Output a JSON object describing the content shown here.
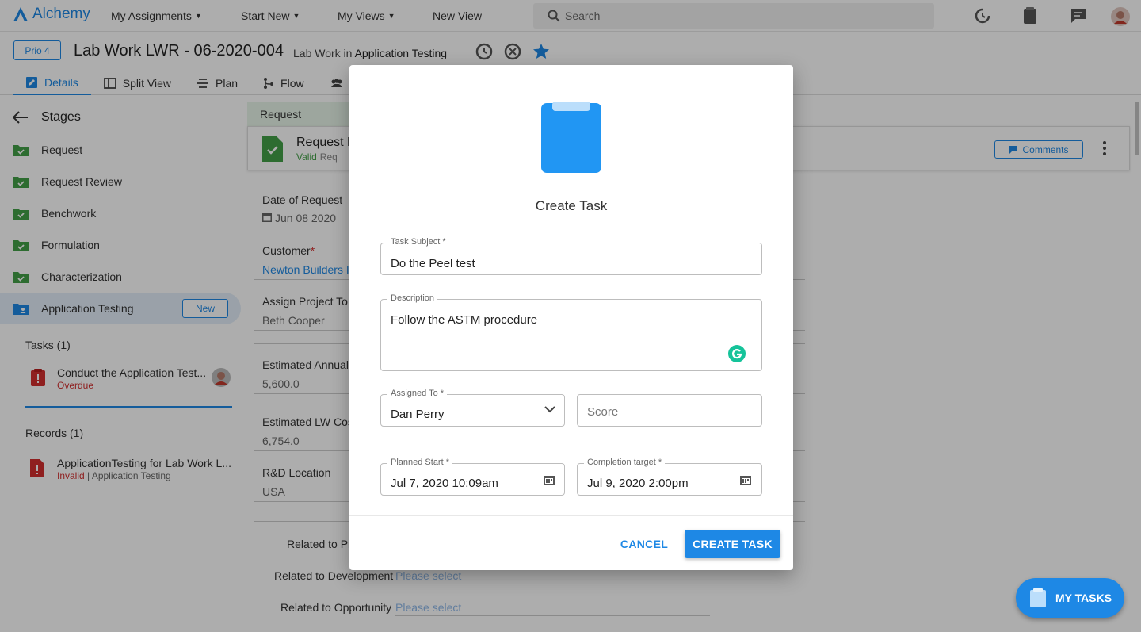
{
  "nav": {
    "brand": "Alchemy",
    "menus": [
      {
        "label": "My Assignments",
        "chevron": true
      },
      {
        "label": "Start New",
        "chevron": true
      },
      {
        "label": "My Views",
        "chevron": true
      },
      {
        "label": "New View",
        "chevron": false
      }
    ],
    "search_placeholder": "Search"
  },
  "header": {
    "priority": "Prio 4",
    "title": "Lab Work LWR - 06-2020-004",
    "subtitle_prefix": "Lab Work in",
    "subtitle_context": "Application Testing",
    "tabs": [
      {
        "label": "Details",
        "icon": "edit-icon",
        "active": true
      },
      {
        "label": "Split View",
        "icon": "split-view-icon",
        "active": false
      },
      {
        "label": "Plan",
        "icon": "plan-icon",
        "active": false
      },
      {
        "label": "Flow",
        "icon": "flow-icon",
        "active": false
      }
    ]
  },
  "sidebar": {
    "heading": "Stages",
    "stages": [
      {
        "label": "Request",
        "status": "complete"
      },
      {
        "label": "Request Review",
        "status": "complete"
      },
      {
        "label": "Benchwork",
        "status": "complete"
      },
      {
        "label": "Formulation",
        "status": "complete"
      },
      {
        "label": "Characterization",
        "status": "complete"
      },
      {
        "label": "Application Testing",
        "status": "active",
        "badge": "New"
      }
    ],
    "tasks_title": "Tasks (1)",
    "tasks": [
      {
        "title": "Conduct the Application Test...",
        "status": "Overdue"
      }
    ],
    "records_title": "Records (1)",
    "records": [
      {
        "title": "ApplicationTesting for Lab Work L...",
        "status": "Invalid",
        "context": "| Application Testing"
      }
    ]
  },
  "main": {
    "section_tab": "Request",
    "card_title": "Request L",
    "card_status": "Valid",
    "card_status_extra": "Req",
    "comments_label": "Comments",
    "fields": [
      {
        "label": "Date of Request",
        "value": "Jun 08 2020"
      },
      {
        "label": "Customer",
        "required_mark": "*",
        "value": "Newton Builders I"
      },
      {
        "label": "Assign Project To",
        "value": "Beth Cooper"
      },
      {
        "label": "Estimated Annual",
        "value": "5,600.0"
      },
      {
        "label": "Estimated LW Cos",
        "value": "6,754.0"
      },
      {
        "label": "R&D Location",
        "value": "USA"
      }
    ],
    "related": [
      {
        "label": "Related to Pr",
        "value": ""
      },
      {
        "label": "Related to Development",
        "value": "Please select"
      },
      {
        "label": "Related to Opportunity",
        "value": "Please select"
      }
    ]
  },
  "modal": {
    "title": "Create Task",
    "task_subject": {
      "label": "Task Subject *",
      "value": "Do the Peel test"
    },
    "description": {
      "label": "Description",
      "value": "Follow the ASTM procedure"
    },
    "assigned_to": {
      "label": "Assigned To *",
      "value": "Dan Perry"
    },
    "score": {
      "placeholder": "Score"
    },
    "planned_start": {
      "label": "Planned Start *",
      "value": "Jul 7, 2020 10:09am"
    },
    "completion_target": {
      "label": "Completion target *",
      "value": "Jul 9, 2020 2:00pm"
    },
    "cancel_label": "CANCEL",
    "create_label": "CREATE TASK"
  },
  "fab": {
    "label": "MY TASKS"
  },
  "colors": {
    "accent": "#1e88e5",
    "success": "#43a047",
    "danger": "#d32f2f"
  }
}
